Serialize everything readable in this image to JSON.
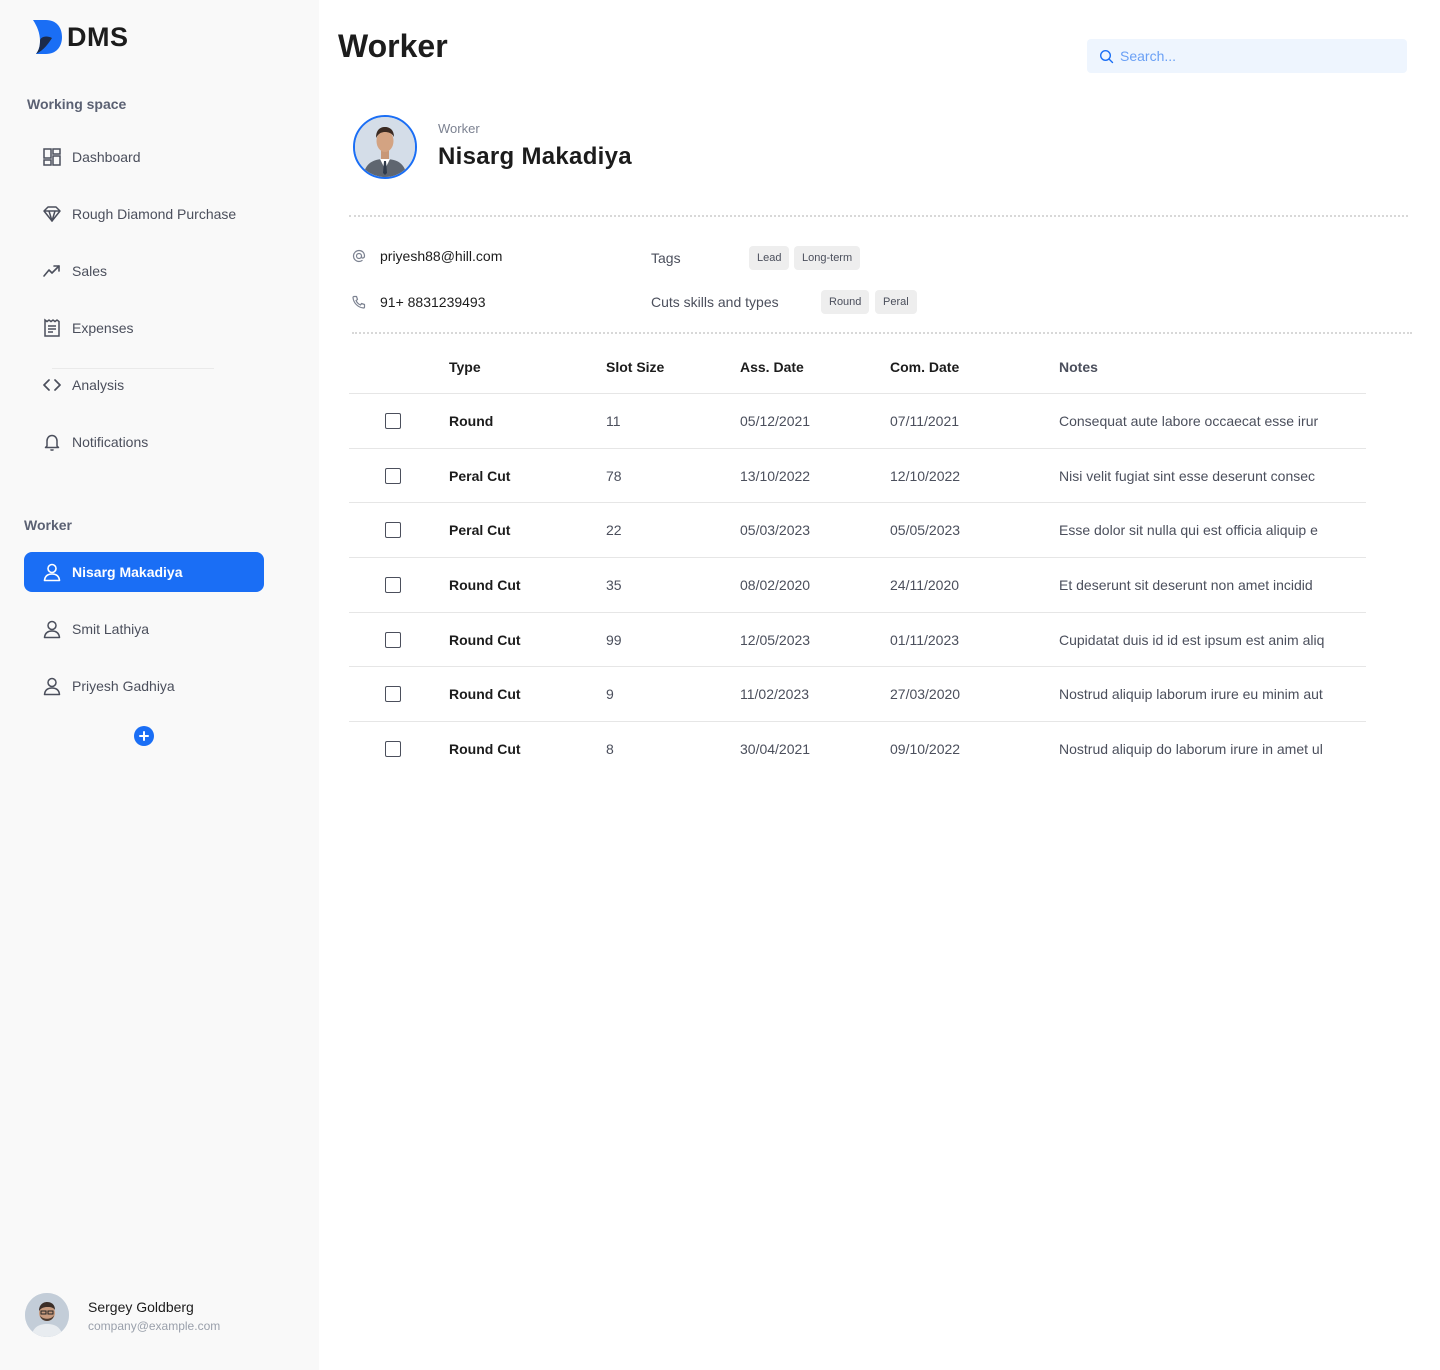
{
  "app": {
    "logo_text": "DMS"
  },
  "sidebar": {
    "working_space_title": "Working space",
    "items": [
      {
        "label": "Dashboard",
        "icon": "dashboard-icon"
      },
      {
        "label": "Rough Diamond Purchase",
        "icon": "diamond-icon"
      },
      {
        "label": "Sales",
        "icon": "trending-up-icon"
      },
      {
        "label": "Expenses",
        "icon": "receipt-icon"
      },
      {
        "label": "Analysis",
        "icon": "code-icon"
      },
      {
        "label": "Notifications",
        "icon": "bell-icon"
      }
    ],
    "worker_title": "Worker",
    "workers": [
      {
        "label": "Nisarg Makadiya",
        "active": true
      },
      {
        "label": "Smit Lathiya",
        "active": false
      },
      {
        "label": "Priyesh Gadhiya",
        "active": false
      }
    ],
    "user": {
      "name": "Sergey Goldberg",
      "email": "company@example.com"
    }
  },
  "header": {
    "title": "Worker",
    "search_placeholder": "Search..."
  },
  "profile": {
    "role": "Worker",
    "name": "Nisarg Makadiya",
    "email": "priyesh88@hill.com",
    "phone": "91+ 8831239493",
    "tags_label": "Tags",
    "tags": [
      "Lead",
      "Long-term"
    ],
    "skills_label": "Cuts skills and types",
    "skills": [
      "Round",
      "Peral"
    ]
  },
  "table": {
    "columns": [
      "Type",
      "Slot Size",
      "Ass. Date",
      "Com. Date",
      "Notes"
    ],
    "rows": [
      {
        "type": "Round",
        "slot": "11",
        "ass": "05/12/2021",
        "com": "07/11/2021",
        "notes": "Consequat aute labore occaecat esse irur"
      },
      {
        "type": "Peral Cut",
        "slot": "78",
        "ass": "13/10/2022",
        "com": "12/10/2022",
        "notes": "Nisi velit fugiat sint esse deserunt consec"
      },
      {
        "type": "Peral Cut",
        "slot": "22",
        "ass": "05/03/2023",
        "com": "05/05/2023",
        "notes": "Esse dolor sit nulla qui est officia aliquip e"
      },
      {
        "type": "Round Cut",
        "slot": "35",
        "ass": "08/02/2020",
        "com": "24/11/2020",
        "notes": "Et deserunt sit deserunt non amet incidid"
      },
      {
        "type": "Round Cut",
        "slot": "99",
        "ass": "12/05/2023",
        "com": "01/11/2023",
        "notes": "Cupidatat duis id id est ipsum est anim aliq"
      },
      {
        "type": "Round Cut",
        "slot": "9",
        "ass": "11/02/2023",
        "com": "27/03/2020",
        "notes": "Nostrud aliquip laborum irure eu minim aut"
      },
      {
        "type": "Round Cut",
        "slot": "8",
        "ass": "30/04/2021",
        "com": "09/10/2022",
        "notes": "Nostrud aliquip do laborum irure in amet ul"
      }
    ]
  },
  "colors": {
    "accent": "#1a6ef5",
    "sidebar_bg": "#f9f9f9",
    "search_bg": "#eef5fe"
  }
}
